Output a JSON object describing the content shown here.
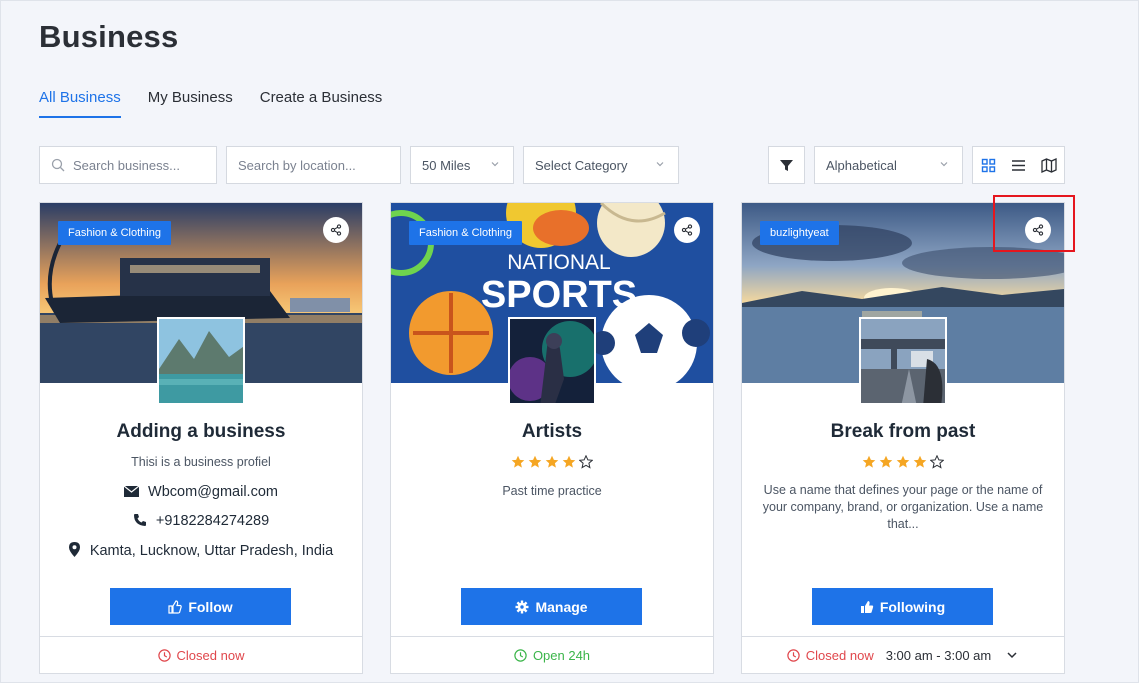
{
  "page": {
    "title": "Business"
  },
  "tabs": [
    {
      "label": "All Business",
      "active": true
    },
    {
      "label": "My Business"
    },
    {
      "label": "Create a Business"
    }
  ],
  "filters": {
    "search_placeholder": "Search business...",
    "location_placeholder": "Search by location...",
    "distance": "50 Miles",
    "category": "Select Category",
    "sort": "Alphabetical"
  },
  "cards": [
    {
      "category": "Fashion & Clothing",
      "title": "Adding a business",
      "description": "Thisi is a business profiel",
      "email": "Wbcom@gmail.com",
      "phone": "+9182284274289",
      "address": "Kamta, Lucknow, Uttar Pradesh, India",
      "button": "Follow",
      "status": "Closed now"
    },
    {
      "category": "Fashion & Clothing",
      "cover_text_1": "NATIONAL",
      "cover_text_2": "SPORTS",
      "title": "Artists",
      "rating": 4,
      "description": "Past time practice",
      "button": "Manage",
      "status": "Open 24h"
    },
    {
      "category": "buzlightyeat",
      "title": "Break from past",
      "rating": 4,
      "description": "Use a name that defines your page or the name of your company, brand, or organization. Use a name that...",
      "button": "Following",
      "status": "Closed now",
      "hours": "3:00 am - 3:00 am"
    }
  ],
  "colors": {
    "accent": "#1e73e8",
    "closed": "#e0474c",
    "open": "#3bb54a",
    "star": "#f5a623"
  }
}
